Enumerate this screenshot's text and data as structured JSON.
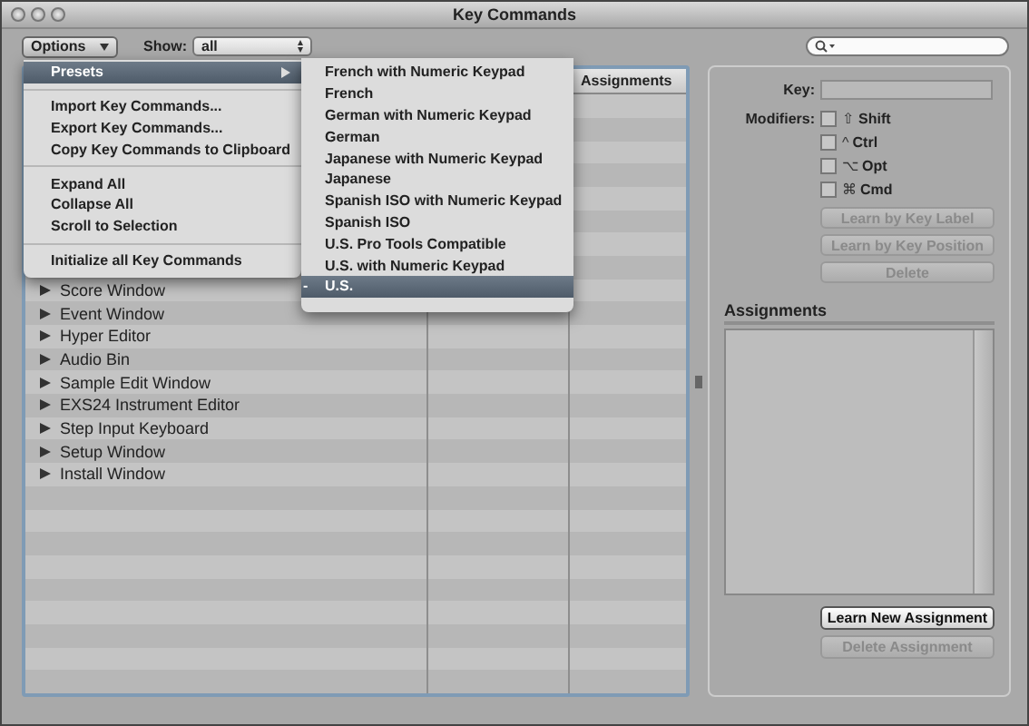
{
  "window": {
    "title": "Key Commands"
  },
  "toolbar": {
    "options_button": "Options",
    "show_label": "Show:",
    "show_value": "all"
  },
  "table": {
    "columns": [
      {
        "label": "Assignments"
      }
    ],
    "rows": [
      {
        "name": "Score Window",
        "expanded": false
      },
      {
        "name": "Event Window",
        "expanded": false
      },
      {
        "name": "Hyper Editor",
        "expanded": false
      },
      {
        "name": "Audio Bin",
        "expanded": false
      },
      {
        "name": "Sample Edit Window",
        "expanded": false
      },
      {
        "name": "EXS24 Instrument Editor",
        "expanded": false
      },
      {
        "name": "Step Input Keyboard",
        "expanded": false
      },
      {
        "name": "Setup Window",
        "expanded": false
      },
      {
        "name": "Install Window",
        "expanded": false
      }
    ]
  },
  "options_menu": [
    {
      "kind": "submenu",
      "label": "Presets",
      "selected": true
    },
    {
      "kind": "separator"
    },
    {
      "kind": "item",
      "label": "Import Key Commands...",
      "selected": false
    },
    {
      "kind": "item",
      "label": "Export Key Commands...",
      "selected": false
    },
    {
      "kind": "item",
      "label": "Copy Key Commands to Clipboard",
      "selected": false
    },
    {
      "kind": "separator"
    },
    {
      "kind": "item",
      "label": "Expand All",
      "selected": false
    },
    {
      "kind": "item",
      "label": "Collapse All",
      "selected": false
    },
    {
      "kind": "item",
      "label": "Scroll to Selection",
      "selected": false
    },
    {
      "kind": "separator"
    },
    {
      "kind": "item",
      "label": "Initialize all Key Commands",
      "selected": false
    }
  ],
  "presets_menu": [
    {
      "label": "French with Numeric Keypad",
      "selected": false
    },
    {
      "label": "French",
      "selected": false
    },
    {
      "label": "German with Numeric Keypad",
      "selected": false
    },
    {
      "label": "German",
      "selected": false
    },
    {
      "label": "Japanese with Numeric Keypad",
      "selected": false
    },
    {
      "label": "Japanese",
      "selected": false
    },
    {
      "label": "Spanish ISO with Numeric Keypad",
      "selected": false
    },
    {
      "label": "Spanish ISO",
      "selected": false
    },
    {
      "label": "U.S. Pro Tools Compatible",
      "selected": false
    },
    {
      "label": "U.S. with Numeric Keypad",
      "selected": false
    },
    {
      "label": "U.S.",
      "selected": true,
      "mark": "-"
    }
  ],
  "inspector": {
    "key_label": "Key:",
    "modifiers_label": "Modifiers:",
    "modifiers": [
      {
        "symbol": "⇧",
        "label": "Shift",
        "checked": false
      },
      {
        "symbol": "^",
        "label": "Ctrl",
        "checked": false
      },
      {
        "symbol": "⌥",
        "label": "Opt",
        "checked": false
      },
      {
        "symbol": "⌘",
        "label": "Cmd",
        "checked": false
      }
    ],
    "buttons": [
      {
        "label": "Learn by Key Label",
        "disabled": true
      },
      {
        "label": "Learn by Key Position",
        "disabled": true
      },
      {
        "label": "Delete",
        "disabled": true
      }
    ],
    "assignments_title": "Assignments",
    "assignment_buttons": [
      {
        "label": "Learn New Assignment",
        "disabled": false
      },
      {
        "label": "Delete Assignment",
        "disabled": true
      }
    ]
  }
}
